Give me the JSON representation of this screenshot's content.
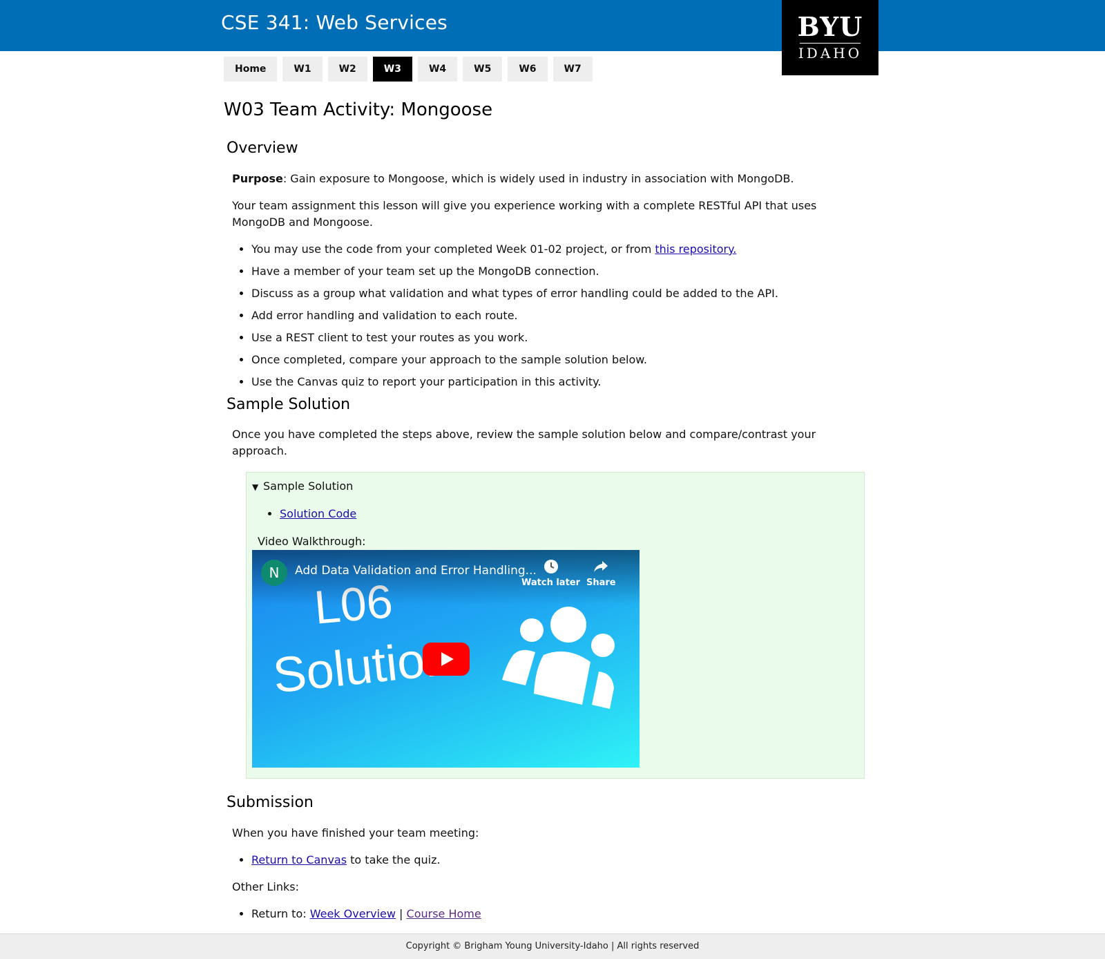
{
  "header": {
    "title": "CSE 341: Web Services",
    "logo": {
      "top": "BYU",
      "bottom": "IDAHO"
    }
  },
  "nav": [
    {
      "label": "Home",
      "active": false
    },
    {
      "label": "W1",
      "active": false
    },
    {
      "label": "W2",
      "active": false
    },
    {
      "label": "W3",
      "active": true
    },
    {
      "label": "W4",
      "active": false
    },
    {
      "label": "W5",
      "active": false
    },
    {
      "label": "W6",
      "active": false
    },
    {
      "label": "W7",
      "active": false
    }
  ],
  "page": {
    "title": "W03 Team Activity: Mongoose"
  },
  "overview": {
    "heading": "Overview",
    "purpose_label": "Purpose",
    "purpose_text": ": Gain exposure to Mongoose, which is widely used in industry in association with MongoDB.",
    "intro": "Your team assignment this lesson will give you experience working with a complete RESTful API that uses MongoDB and Mongoose.",
    "list": {
      "item1_text": "You may use the code from your completed Week 01-02 project, or from ",
      "item1_link": "this repository.",
      "item2": "Have a member of your team set up the MongoDB connection.",
      "item3": "Discuss as a group what validation and what types of error handling could be added to the API.",
      "item4": "Add error handling and validation to each route.",
      "item5": "Use a REST client to test your routes as you work.",
      "item6": "Once completed, compare your approach to the sample solution below.",
      "item7": "Use the Canvas quiz to report your participation in this activity."
    }
  },
  "sample": {
    "heading": "Sample Solution",
    "intro": "Once you have completed the steps above, review the sample solution below and compare/contrast your approach.",
    "summary": "Sample Solution",
    "solution_link": "Solution Code",
    "video_label": "Video Walkthrough:",
    "video": {
      "channel_initial": "N",
      "title": "Add Data Validation and Error Handling...",
      "watch_later": "Watch later",
      "share": "Share",
      "thumb_line1": "L06",
      "thumb_line2": "Solution"
    }
  },
  "submission": {
    "heading": "Submission",
    "intro": "When you have finished your team meeting:",
    "canvas_link": "Return to Canvas",
    "canvas_suffix": " to take the quiz.",
    "other_label": "Other Links:",
    "return_prefix": "Return to: ",
    "week_link": "Week Overview",
    "separator": " | ",
    "course_link": "Course Home"
  },
  "footer": {
    "text": "Copyright © Brigham Young University-Idaho | All rights reserved"
  },
  "colors": {
    "header_blue": "#006eb6",
    "solution_bg": "#ebfbeb",
    "link": "#1a0dab",
    "visited_link": "#5b2a86"
  }
}
